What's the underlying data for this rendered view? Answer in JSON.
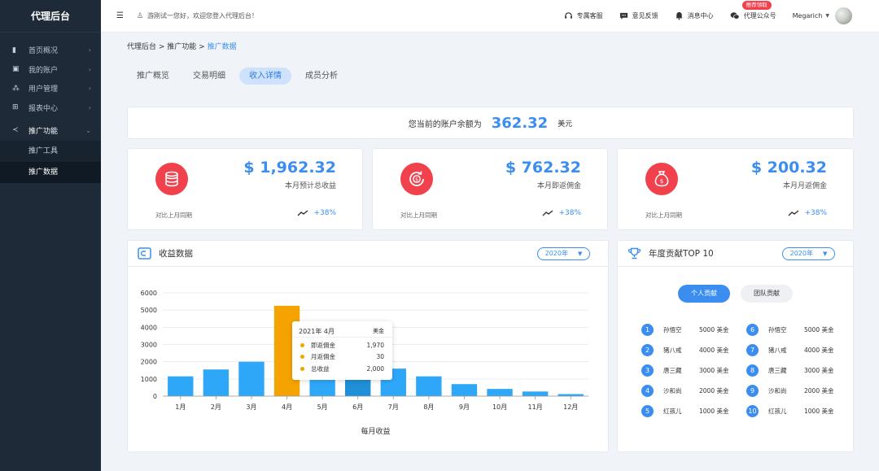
{
  "app_title": "代理后台",
  "sidebar": {
    "items": [
      {
        "label": "首页概况",
        "icon": "bar-chart-icon",
        "chevron": "›"
      },
      {
        "label": "我的账户",
        "icon": "account-icon",
        "chevron": "›"
      },
      {
        "label": "用户管理",
        "icon": "users-icon",
        "chevron": "›"
      },
      {
        "label": "报表中心",
        "icon": "grid-icon",
        "chevron": "›"
      },
      {
        "label": "推广功能",
        "icon": "share-icon",
        "chevron": "⌄",
        "active": true
      }
    ],
    "sub_items": [
      {
        "label": "推广工具"
      },
      {
        "label": "推广数据",
        "active": true
      }
    ]
  },
  "header": {
    "welcome": "游刚试一您好，欢迎您登入代理后台！",
    "support": "专属客服",
    "feedback": "意见反馈",
    "messages": "消息中心",
    "wechat": "代理公众号",
    "wechat_badge": "推荐领取",
    "username": "Megarich"
  },
  "breadcrumb": {
    "parts": [
      "代理后台",
      " > ",
      "推广功能",
      " > "
    ],
    "current": "推广数据"
  },
  "tabs": [
    {
      "label": "推广概览"
    },
    {
      "label": "交易明细"
    },
    {
      "label": "收入详情",
      "active": true
    },
    {
      "label": "成员分析"
    }
  ],
  "balance": {
    "label": "您当前的账户余额为",
    "value": "362.32",
    "unit": "美元"
  },
  "stats": [
    {
      "value": "$ 1,962.32",
      "caption": "本月预计总收益",
      "compare": "对比上月同期",
      "trend": "+38%",
      "icon": "coins-icon"
    },
    {
      "value": "$ 762.32",
      "caption": "本月即返佣金",
      "compare": "对比上月同期",
      "trend": "+38%",
      "icon": "cashback-icon"
    },
    {
      "value": "$ 200.32",
      "caption": "本月月返佣金",
      "compare": "对比上月同期",
      "trend": "+38%",
      "icon": "money-bag-icon"
    }
  ],
  "income_panel": {
    "title": "收益数据",
    "year": "2020年"
  },
  "chart_data": {
    "type": "bar",
    "categories": [
      "1月",
      "2月",
      "3月",
      "4月",
      "5月",
      "6月",
      "7月",
      "8月",
      "9月",
      "10月",
      "11月",
      "12月"
    ],
    "values": [
      1150,
      1550,
      2000,
      5250,
      1300,
      1000,
      1600,
      1150,
      700,
      420,
      270,
      120
    ],
    "xlabel": "每月收益",
    "ylabel": "",
    "ylim": [
      0,
      6000
    ],
    "yticks": [
      0,
      1000,
      2000,
      3000,
      4000,
      5000,
      6000
    ],
    "grid": true,
    "highlight_index": 3,
    "colors": {
      "bar": "#2ea7f8",
      "highlight": "#f5a300",
      "hover": "#1e8fd8"
    },
    "tooltip": {
      "title": "2021年 4月",
      "unit": "美金",
      "rows": [
        {
          "label": "即返佣金",
          "value": "1,970"
        },
        {
          "label": "月返佣金",
          "value": "30"
        },
        {
          "label": "总收益",
          "value": "2,000"
        }
      ]
    }
  },
  "top10": {
    "title": "年度贡献TOP 10",
    "year": "2020年",
    "btn_personal": "个人贡献",
    "btn_team": "团队贡献",
    "left": [
      {
        "rank": "1",
        "name": "孙悟空",
        "score": "5000 美金"
      },
      {
        "rank": "2",
        "name": "猪八戒",
        "score": "4000 美金"
      },
      {
        "rank": "3",
        "name": "唐三藏",
        "score": "3000 美金"
      },
      {
        "rank": "4",
        "name": "沙和尚",
        "score": "2000 美金"
      },
      {
        "rank": "5",
        "name": "红孩儿",
        "score": "1000 美金"
      }
    ],
    "right": [
      {
        "rank": "6",
        "name": "孙悟空",
        "score": "5000 美金"
      },
      {
        "rank": "7",
        "name": "猪八戒",
        "score": "4000 美金"
      },
      {
        "rank": "8",
        "name": "唐三藏",
        "score": "3000 美金"
      },
      {
        "rank": "9",
        "name": "沙和尚",
        "score": "2000 美金"
      },
      {
        "rank": "10",
        "name": "红孩儿",
        "score": "1000 美金"
      }
    ]
  }
}
